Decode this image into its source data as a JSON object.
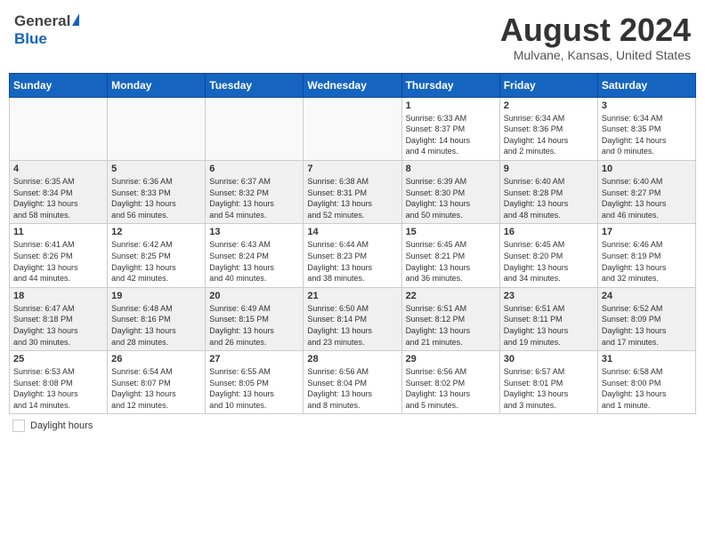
{
  "header": {
    "logo_general": "General",
    "logo_blue": "Blue",
    "month_year": "August 2024",
    "location": "Mulvane, Kansas, United States"
  },
  "days_of_week": [
    "Sunday",
    "Monday",
    "Tuesday",
    "Wednesday",
    "Thursday",
    "Friday",
    "Saturday"
  ],
  "weeks": [
    [
      {
        "day": "",
        "info": ""
      },
      {
        "day": "",
        "info": ""
      },
      {
        "day": "",
        "info": ""
      },
      {
        "day": "",
        "info": ""
      },
      {
        "day": "1",
        "info": "Sunrise: 6:33 AM\nSunset: 8:37 PM\nDaylight: 14 hours\nand 4 minutes."
      },
      {
        "day": "2",
        "info": "Sunrise: 6:34 AM\nSunset: 8:36 PM\nDaylight: 14 hours\nand 2 minutes."
      },
      {
        "day": "3",
        "info": "Sunrise: 6:34 AM\nSunset: 8:35 PM\nDaylight: 14 hours\nand 0 minutes."
      }
    ],
    [
      {
        "day": "4",
        "info": "Sunrise: 6:35 AM\nSunset: 8:34 PM\nDaylight: 13 hours\nand 58 minutes."
      },
      {
        "day": "5",
        "info": "Sunrise: 6:36 AM\nSunset: 8:33 PM\nDaylight: 13 hours\nand 56 minutes."
      },
      {
        "day": "6",
        "info": "Sunrise: 6:37 AM\nSunset: 8:32 PM\nDaylight: 13 hours\nand 54 minutes."
      },
      {
        "day": "7",
        "info": "Sunrise: 6:38 AM\nSunset: 8:31 PM\nDaylight: 13 hours\nand 52 minutes."
      },
      {
        "day": "8",
        "info": "Sunrise: 6:39 AM\nSunset: 8:30 PM\nDaylight: 13 hours\nand 50 minutes."
      },
      {
        "day": "9",
        "info": "Sunrise: 6:40 AM\nSunset: 8:28 PM\nDaylight: 13 hours\nand 48 minutes."
      },
      {
        "day": "10",
        "info": "Sunrise: 6:40 AM\nSunset: 8:27 PM\nDaylight: 13 hours\nand 46 minutes."
      }
    ],
    [
      {
        "day": "11",
        "info": "Sunrise: 6:41 AM\nSunset: 8:26 PM\nDaylight: 13 hours\nand 44 minutes."
      },
      {
        "day": "12",
        "info": "Sunrise: 6:42 AM\nSunset: 8:25 PM\nDaylight: 13 hours\nand 42 minutes."
      },
      {
        "day": "13",
        "info": "Sunrise: 6:43 AM\nSunset: 8:24 PM\nDaylight: 13 hours\nand 40 minutes."
      },
      {
        "day": "14",
        "info": "Sunrise: 6:44 AM\nSunset: 8:23 PM\nDaylight: 13 hours\nand 38 minutes."
      },
      {
        "day": "15",
        "info": "Sunrise: 6:45 AM\nSunset: 8:21 PM\nDaylight: 13 hours\nand 36 minutes."
      },
      {
        "day": "16",
        "info": "Sunrise: 6:45 AM\nSunset: 8:20 PM\nDaylight: 13 hours\nand 34 minutes."
      },
      {
        "day": "17",
        "info": "Sunrise: 6:46 AM\nSunset: 8:19 PM\nDaylight: 13 hours\nand 32 minutes."
      }
    ],
    [
      {
        "day": "18",
        "info": "Sunrise: 6:47 AM\nSunset: 8:18 PM\nDaylight: 13 hours\nand 30 minutes."
      },
      {
        "day": "19",
        "info": "Sunrise: 6:48 AM\nSunset: 8:16 PM\nDaylight: 13 hours\nand 28 minutes."
      },
      {
        "day": "20",
        "info": "Sunrise: 6:49 AM\nSunset: 8:15 PM\nDaylight: 13 hours\nand 26 minutes."
      },
      {
        "day": "21",
        "info": "Sunrise: 6:50 AM\nSunset: 8:14 PM\nDaylight: 13 hours\nand 23 minutes."
      },
      {
        "day": "22",
        "info": "Sunrise: 6:51 AM\nSunset: 8:12 PM\nDaylight: 13 hours\nand 21 minutes."
      },
      {
        "day": "23",
        "info": "Sunrise: 6:51 AM\nSunset: 8:11 PM\nDaylight: 13 hours\nand 19 minutes."
      },
      {
        "day": "24",
        "info": "Sunrise: 6:52 AM\nSunset: 8:09 PM\nDaylight: 13 hours\nand 17 minutes."
      }
    ],
    [
      {
        "day": "25",
        "info": "Sunrise: 6:53 AM\nSunset: 8:08 PM\nDaylight: 13 hours\nand 14 minutes."
      },
      {
        "day": "26",
        "info": "Sunrise: 6:54 AM\nSunset: 8:07 PM\nDaylight: 13 hours\nand 12 minutes."
      },
      {
        "day": "27",
        "info": "Sunrise: 6:55 AM\nSunset: 8:05 PM\nDaylight: 13 hours\nand 10 minutes."
      },
      {
        "day": "28",
        "info": "Sunrise: 6:56 AM\nSunset: 8:04 PM\nDaylight: 13 hours\nand 8 minutes."
      },
      {
        "day": "29",
        "info": "Sunrise: 6:56 AM\nSunset: 8:02 PM\nDaylight: 13 hours\nand 5 minutes."
      },
      {
        "day": "30",
        "info": "Sunrise: 6:57 AM\nSunset: 8:01 PM\nDaylight: 13 hours\nand 3 minutes."
      },
      {
        "day": "31",
        "info": "Sunrise: 6:58 AM\nSunset: 8:00 PM\nDaylight: 13 hours\nand 1 minute."
      }
    ]
  ],
  "footer": {
    "daylight_label": "Daylight hours"
  }
}
